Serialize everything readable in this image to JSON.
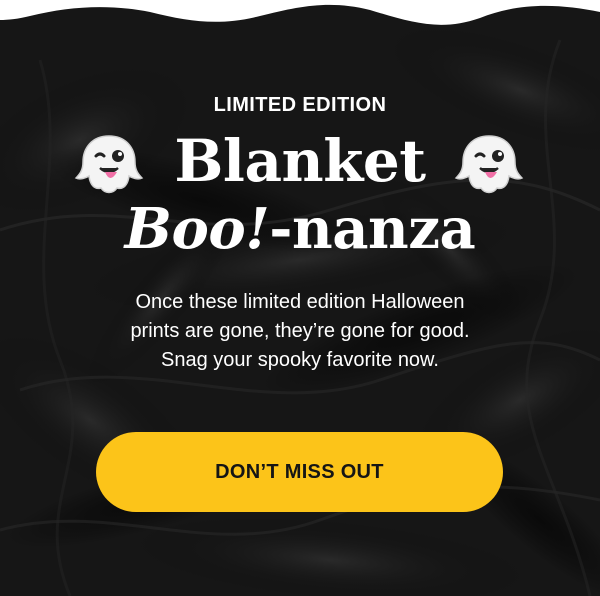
{
  "promo": {
    "eyebrow": "LIMITED EDITION",
    "headline": {
      "line1": "Blanket",
      "line2_italic": "Boo!",
      "line2_rest": "-nanza"
    },
    "body_line1": "Once these limited edition Halloween",
    "body_line2": "prints are gone, they’re gone for good.",
    "body_line3": "Snag your spooky favorite now.",
    "cta_label": "DON’T MISS OUT",
    "decorations": {
      "left_icon": "winking-ghost-icon",
      "right_icon": "winking-ghost-icon"
    }
  },
  "colors": {
    "background": "#161616",
    "text": "#ffffff",
    "cta_background": "#fcc419",
    "cta_text": "#151515"
  }
}
